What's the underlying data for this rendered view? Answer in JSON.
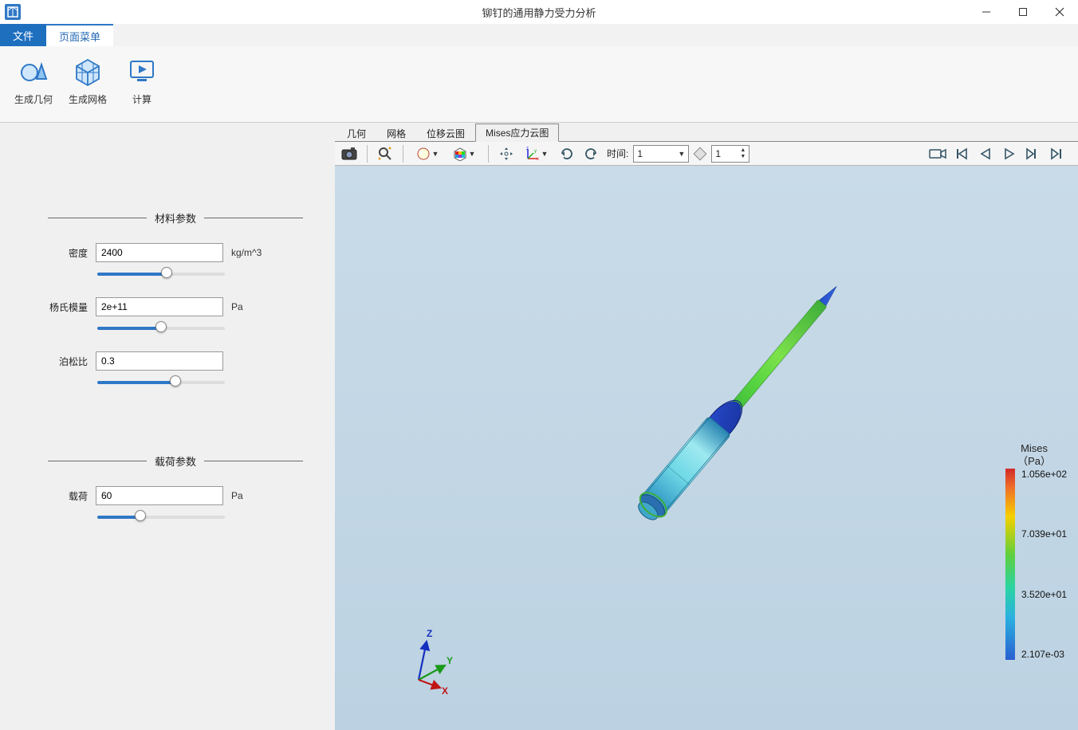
{
  "window": {
    "title": "铆钉的通用静力受力分析"
  },
  "menubar": {
    "file": "文件",
    "page_menu": "页面菜单"
  },
  "ribbon": {
    "gen_geometry": "生成几何",
    "gen_mesh": "生成网格",
    "compute": "计算"
  },
  "sidebar": {
    "material_section": "材料参数",
    "density_label": "密度",
    "density_value": "2400",
    "density_unit": "kg/m^3",
    "young_label": "杨氏模量",
    "young_value": "2e+11",
    "young_unit": "Pa",
    "poisson_label": "泊松比",
    "poisson_value": "0.3",
    "load_section": "载荷参数",
    "load_label": "载荷",
    "load_value": "60",
    "load_unit": "Pa"
  },
  "viewer_tabs": {
    "geometry": "几何",
    "mesh": "网格",
    "disp": "位移云图",
    "mises": "Mises应力云图"
  },
  "toolbar": {
    "time_label": "时间:",
    "time_value": "1",
    "step_value": "1"
  },
  "legend": {
    "title1": "Mises",
    "title2": "（Pa）",
    "max": "1.056e+02",
    "mid_high": "7.039e+01",
    "mid_low": "3.520e+01",
    "min": "2.107e-03"
  },
  "triad": {
    "x": "X",
    "y": "Y",
    "z": "Z"
  }
}
